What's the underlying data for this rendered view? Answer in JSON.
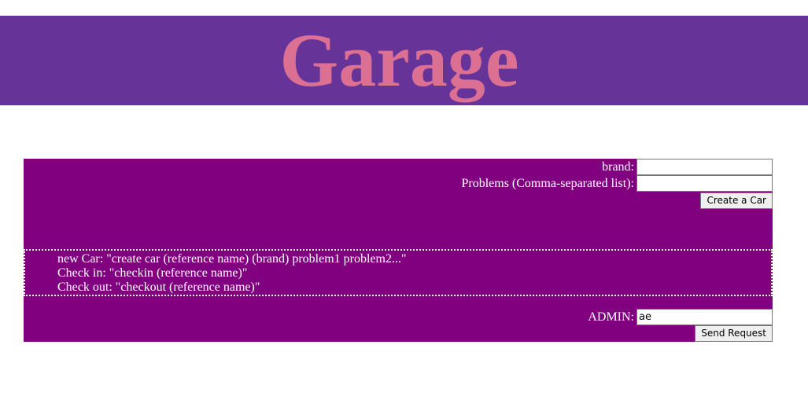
{
  "header": {
    "title": "Garage"
  },
  "create_form": {
    "brand_label": "brand:",
    "brand_value": "",
    "problems_label": "Problems (Comma-separated list):",
    "problems_value": "",
    "submit_label": "Create a Car"
  },
  "help": {
    "lines": [
      "new Car: \"create car (reference name) (brand) problem1 problem2...\"",
      "Check in: \"checkin (reference name)\"",
      "Check out: \"checkout (reference name)\""
    ]
  },
  "admin_form": {
    "label": "ADMIN:",
    "value": "ae",
    "submit_label": "Send Request"
  },
  "colors": {
    "header_bg": "#663399",
    "title": "#db7093",
    "panel_bg": "#800080"
  }
}
